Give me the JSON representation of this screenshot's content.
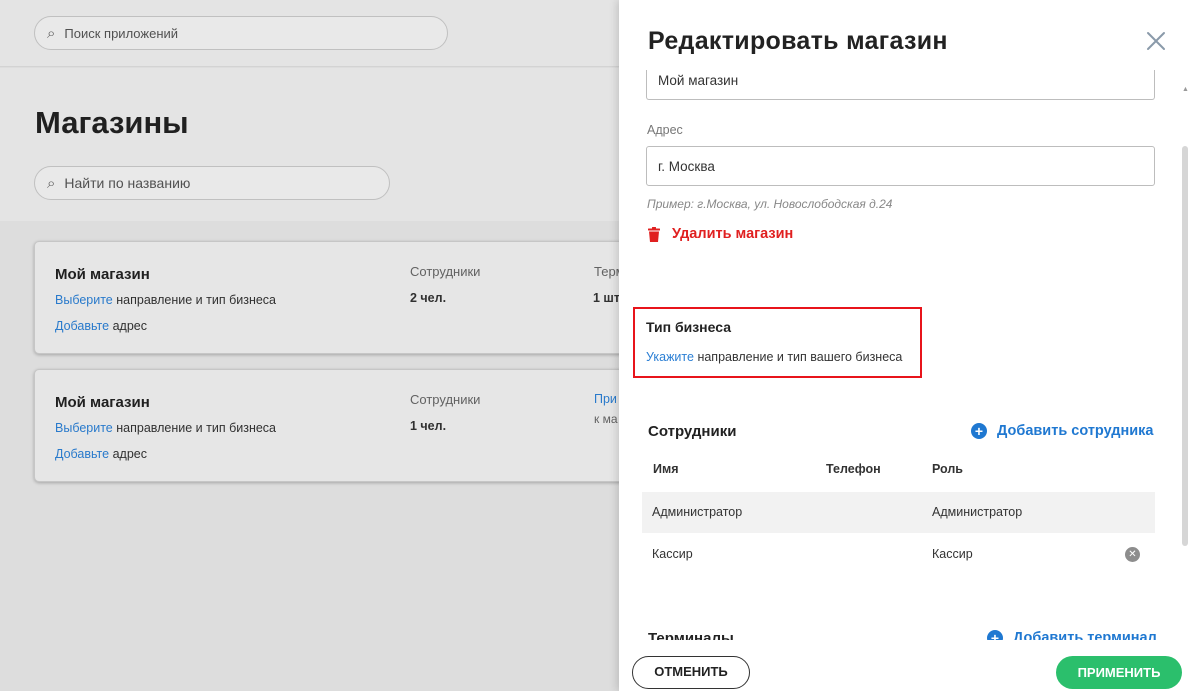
{
  "background": {
    "app_search_placeholder": "Поиск приложений",
    "page_title": "Магазины",
    "name_search_placeholder": "Найти по названию",
    "stores": [
      {
        "name": "Мой магазин",
        "biz_link": "Выберите",
        "biz_text": " направление и тип бизнеса",
        "addr_link": "Добавьте",
        "addr_text": " адрес",
        "employees_label": "Сотрудники",
        "employees_value": "2 чел.",
        "terminals_label": "Терм",
        "terminals_value": "1 шт"
      },
      {
        "name": "Мой магазин",
        "biz_link": "Выберите",
        "biz_text": " направление и тип бизнеса",
        "addr_link": "Добавьте",
        "addr_text": " адрес",
        "employees_label": "Сотрудники",
        "employees_value": "1 чел.",
        "terminals_link": "При",
        "terminals_sub": "к ма"
      }
    ]
  },
  "drawer": {
    "title": "Редактировать магазин",
    "name_value": "Мой магазин",
    "address_label": "Адрес",
    "address_value": "г. Москва",
    "address_hint": "Пример: г.Москва, ул. Новослободская д.24",
    "delete_label": "Удалить магазин",
    "business": {
      "title": "Тип бизнеса",
      "link": "Укажите",
      "text": " направление и тип вашего бизнеса"
    },
    "employees": {
      "title": "Сотрудники",
      "add_label": "Добавить сотрудника",
      "columns": [
        "Имя",
        "Телефон",
        "Роль"
      ],
      "rows": [
        {
          "name": "Администратор",
          "phone": "",
          "role": "Администратор"
        },
        {
          "name": "Кассир",
          "phone": "",
          "role": "Кассир"
        }
      ]
    },
    "terminals": {
      "title": "Терминалы",
      "add_label": "Добавить терминал"
    },
    "cancel_label": "ОТМЕНИТЬ",
    "apply_label": "ПРИМЕНИТЬ"
  },
  "colors": {
    "accent": "#1f78d1",
    "danger": "#e02020",
    "apply": "#2bbf6c",
    "highlight": "#e8141b"
  }
}
